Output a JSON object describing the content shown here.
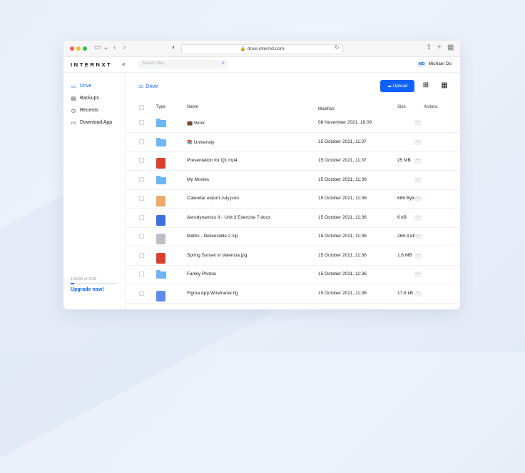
{
  "browser": {
    "url": "drive.internxt.com"
  },
  "app": {
    "logo": "INTERNXT",
    "collapse": "«",
    "search_placeholder": "Search files",
    "user_initials": "MD",
    "user_name": "Michael Do"
  },
  "sidebar": {
    "items": [
      {
        "label": "Drive",
        "icon": "folder-icon"
      },
      {
        "label": "Backups",
        "icon": "backup-drive-icon"
      },
      {
        "label": "Recents",
        "icon": "clock-icon"
      },
      {
        "label": "Download App",
        "icon": "monitor-icon"
      }
    ],
    "usage": "135MB of 2GB",
    "usage_fraction": 0.07,
    "upgrade": "Upgrade now!"
  },
  "main": {
    "breadcrumb": "Drive",
    "upload_label": "Upload",
    "columns": {
      "type": "Type",
      "name": "Name",
      "modified": "Modified",
      "size": "Size",
      "actions": "Actions"
    },
    "rows": [
      {
        "name": "💼 Work",
        "modified": "08 November 2021, 18:09",
        "size": "",
        "kind": "folder"
      },
      {
        "name": "📚 University",
        "modified": "15 October 2021, 11:37",
        "size": "",
        "kind": "folder"
      },
      {
        "name": "Presentation for Q1.mp4",
        "modified": "15 October 2021, 11:37",
        "size": "25 MB",
        "kind": "video",
        "color": "#d9412e"
      },
      {
        "name": "My Movies",
        "modified": "15 October 2021, 11:36",
        "size": "",
        "kind": "folder"
      },
      {
        "name": "Calendar export July.json",
        "modified": "15 October 2021, 11:36",
        "size": "686 Bytes",
        "kind": "json",
        "color": "#f0a868"
      },
      {
        "name": "Aerodynamics II - Unit 3 Exercise 7.docx",
        "modified": "15 October 2021, 11:36",
        "size": "6 kB",
        "kind": "word",
        "color": "#3b6fe0"
      },
      {
        "name": "Maths - Deliverable 2.zip",
        "modified": "15 October 2021, 11:36",
        "size": "268.3 kB",
        "kind": "zip",
        "color": "#b9c0ca"
      },
      {
        "name": "Spring Sunset in Valencia.jpg",
        "modified": "15 October 2021, 11:36",
        "size": "1.6 MB",
        "kind": "image",
        "color": "#d9412e"
      },
      {
        "name": "Family Photos",
        "modified": "15 October 2021, 11:36",
        "size": "",
        "kind": "folder"
      },
      {
        "name": "Figma App Wireframe.fig",
        "modified": "15 October 2021, 11:36",
        "size": "17.8 kB",
        "kind": "figma",
        "color": "#5b8def"
      }
    ]
  }
}
